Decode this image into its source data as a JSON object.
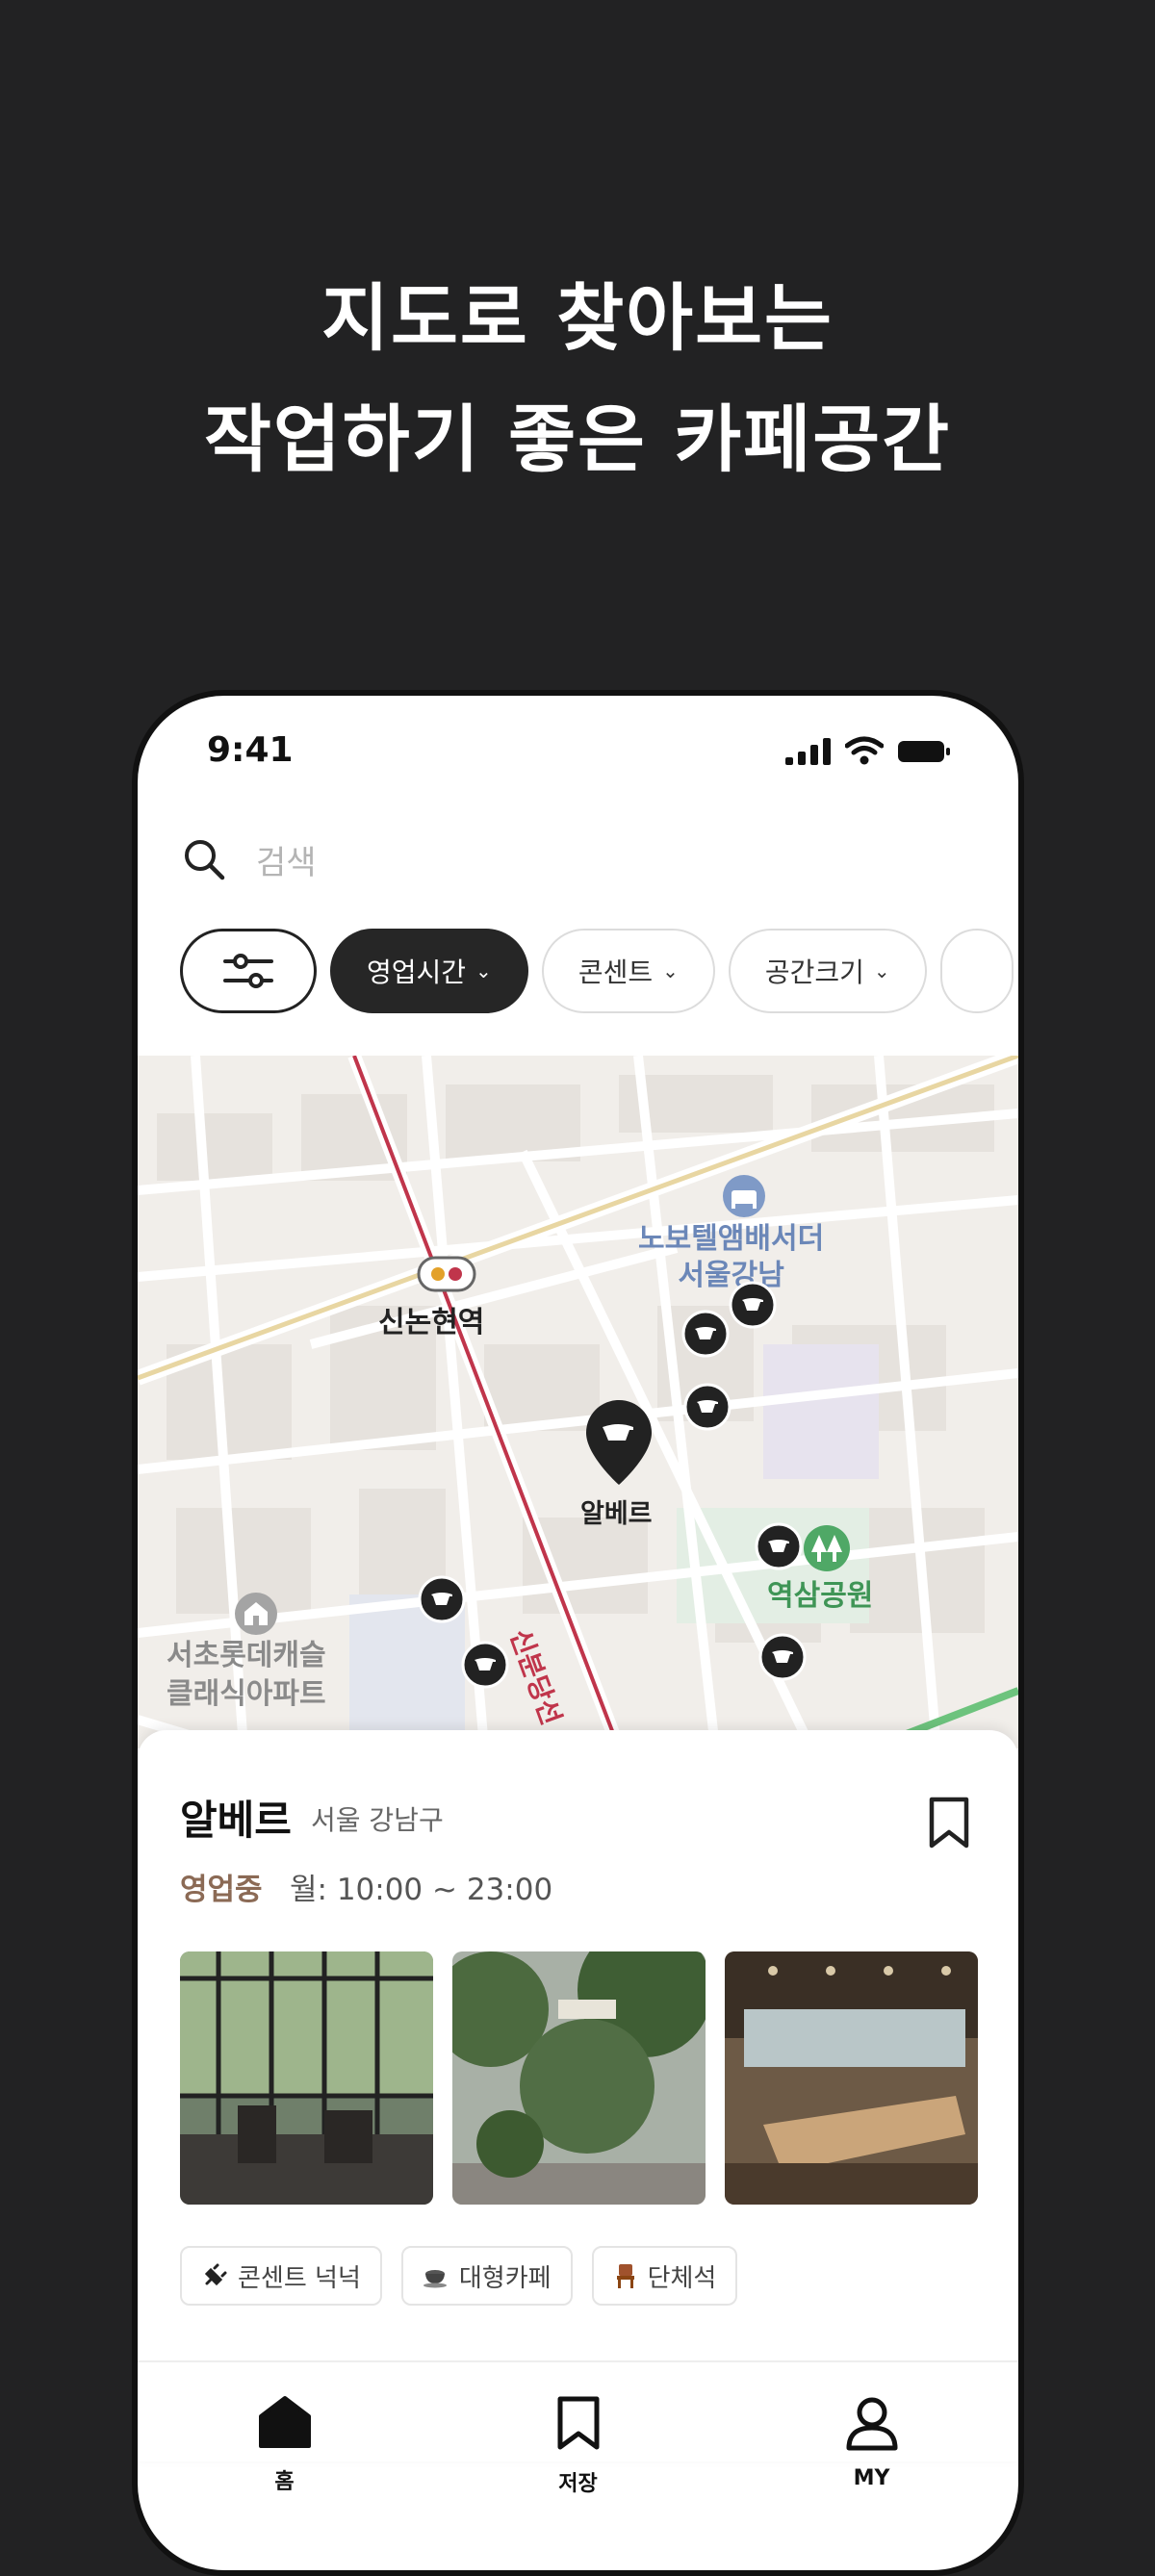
{
  "headline": {
    "line1": "지도로 찾아보는",
    "line2": "작업하기 좋은 카페공간"
  },
  "status_bar": {
    "time": "9:41"
  },
  "search": {
    "placeholder": "검색"
  },
  "filters": [
    {
      "label": "영업시간",
      "selected": true
    },
    {
      "label": "콘센트",
      "selected": false
    },
    {
      "label": "공간크기",
      "selected": false
    }
  ],
  "map": {
    "labels": {
      "station": "신논현역",
      "hotel_line1": "노보텔앰배서더",
      "hotel_line2": "서울강남",
      "park": "역삼공원",
      "apartment_line1": "서초롯데캐슬",
      "apartment_line2": "클래식아파트",
      "road": "신분당선",
      "selected_cafe": "알베르"
    }
  },
  "cafe": {
    "name": "알베르",
    "location": "서울 강남구",
    "status": "영업중",
    "hours": "월: 10:00 ~ 23:00",
    "tags": [
      "콘센트 넉넉",
      "대형카페",
      "단체석"
    ]
  },
  "tabs": [
    {
      "label": "홈"
    },
    {
      "label": "저장"
    },
    {
      "label": "MY"
    }
  ],
  "colors": {
    "background": "#222223",
    "accent": "#8b6a55",
    "map_bg": "#f1eeea",
    "subway_line": "#c0354b"
  }
}
